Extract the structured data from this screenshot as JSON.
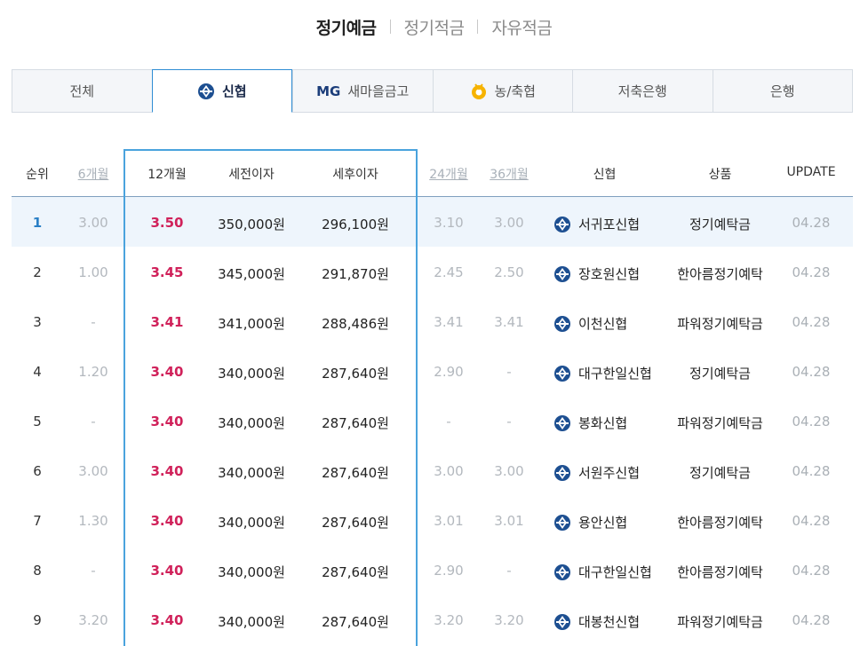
{
  "top_tabs": [
    {
      "label": "정기예금",
      "active": true
    },
    {
      "label": "정기적금",
      "active": false
    },
    {
      "label": "자유적금",
      "active": false
    }
  ],
  "inst_tabs": [
    {
      "label": "전체",
      "icon": null,
      "active": false
    },
    {
      "label": "신협",
      "icon": "shinhyup-icon",
      "active": true
    },
    {
      "label": "새마을금고",
      "icon": "mg-logo",
      "logo_text": "MG",
      "active": false
    },
    {
      "label": "농/축협",
      "icon": "nonghyup-icon",
      "active": false
    },
    {
      "label": "저축은행",
      "icon": null,
      "active": false
    },
    {
      "label": "은행",
      "icon": null,
      "active": false
    }
  ],
  "table": {
    "headers": {
      "rank": "순위",
      "m6": "6개월",
      "m12": "12개월",
      "pretax": "세전이자",
      "aftertax": "세후이자",
      "m24": "24개월",
      "m36": "36개월",
      "bank": "신협",
      "product": "상품",
      "update": "UPDATE"
    },
    "rows": [
      {
        "rank": "1",
        "m6": "3.00",
        "m12": "3.50",
        "pretax": "350,000원",
        "aftertax": "296,100원",
        "m24": "3.10",
        "m36": "3.00",
        "bank": "서귀포신협",
        "product": "정기예탁금",
        "update": "04.28",
        "highlight": true
      },
      {
        "rank": "2",
        "m6": "1.00",
        "m12": "3.45",
        "pretax": "345,000원",
        "aftertax": "291,870원",
        "m24": "2.45",
        "m36": "2.50",
        "bank": "장호원신협",
        "product": "한아름정기예탁",
        "update": "04.28"
      },
      {
        "rank": "3",
        "m6": "-",
        "m12": "3.41",
        "pretax": "341,000원",
        "aftertax": "288,486원",
        "m24": "3.41",
        "m36": "3.41",
        "bank": "이천신협",
        "product": "파워정기예탁금",
        "update": "04.28"
      },
      {
        "rank": "4",
        "m6": "1.20",
        "m12": "3.40",
        "pretax": "340,000원",
        "aftertax": "287,640원",
        "m24": "2.90",
        "m36": "-",
        "bank": "대구한일신협",
        "product": "정기예탁금",
        "update": "04.28"
      },
      {
        "rank": "5",
        "m6": "-",
        "m12": "3.40",
        "pretax": "340,000원",
        "aftertax": "287,640원",
        "m24": "-",
        "m36": "-",
        "bank": "봉화신협",
        "product": "파워정기예탁금",
        "update": "04.28"
      },
      {
        "rank": "6",
        "m6": "3.00",
        "m12": "3.40",
        "pretax": "340,000원",
        "aftertax": "287,640원",
        "m24": "3.00",
        "m36": "3.00",
        "bank": "서원주신협",
        "product": "정기예탁금",
        "update": "04.28"
      },
      {
        "rank": "7",
        "m6": "1.30",
        "m12": "3.40",
        "pretax": "340,000원",
        "aftertax": "287,640원",
        "m24": "3.01",
        "m36": "3.01",
        "bank": "용안신협",
        "product": "한아름정기예탁",
        "update": "04.28"
      },
      {
        "rank": "8",
        "m6": "-",
        "m12": "3.40",
        "pretax": "340,000원",
        "aftertax": "287,640원",
        "m24": "2.90",
        "m36": "-",
        "bank": "대구한일신협",
        "product": "한아름정기예탁",
        "update": "04.28"
      },
      {
        "rank": "9",
        "m6": "3.20",
        "m12": "3.40",
        "pretax": "340,000원",
        "aftertax": "287,640원",
        "m24": "3.20",
        "m36": "3.20",
        "bank": "대봉천신협",
        "product": "파워정기예탁금",
        "update": "04.28"
      }
    ]
  },
  "colors": {
    "accent_blue": "#2f8dd4",
    "rate_red": "#d0215a",
    "muted_gray": "#b3b8be",
    "highlight_row": "#eef5fc"
  }
}
